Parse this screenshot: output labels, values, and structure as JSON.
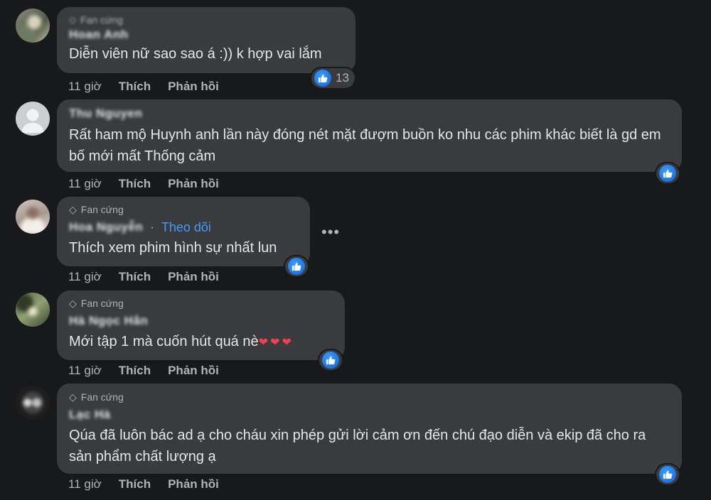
{
  "colors": {
    "background": "#18191a",
    "bubble": "#3a3b3c",
    "text": "#e4e6eb",
    "secondary_text": "#b0b3b8",
    "link": "#4599ff",
    "like_blue": "#0b63dd"
  },
  "comments": [
    {
      "badge": "Fan cứng",
      "author": "Hoan Anh",
      "text": "Diễn viên nữ sao sao á :)) k hợp vai lắm",
      "reaction_icon": "thumbs-up-icon",
      "reaction_count": "13",
      "time": "11 giờ",
      "like_label": "Thích",
      "reply_label": "Phản hồi"
    },
    {
      "author": "Thu Nguyen",
      "text": "Rất ham mộ Huynh anh lần này đóng nét mặt đượm buồn ko nhu các phim khác biết là gd em bố mới mất Thống cảm",
      "reaction_icon": "thumbs-up-icon",
      "time": "11 giờ",
      "like_label": "Thích",
      "reply_label": "Phản hồi"
    },
    {
      "badge": "Fan cứng",
      "author": "Hoa Nguyễn",
      "follow_label": "Theo dõi",
      "text": "Thích xem phim hình sự nhất lun",
      "more_label": "•••",
      "reaction_icon": "thumbs-up-icon",
      "time": "11 giờ",
      "like_label": "Thích",
      "reply_label": "Phản hồi"
    },
    {
      "badge": "Fan cứng",
      "author": "Hà Ngọc Hân",
      "text": "Mới tập 1 mà cuốn hút quá nè",
      "emoji": "❤❤❤",
      "reaction_icon": "thumbs-up-icon",
      "time": "11 giờ",
      "like_label": "Thích",
      "reply_label": "Phản hồi"
    },
    {
      "badge": "Fan cứng",
      "author": "Lạc Hà",
      "text": "Qúa đã luôn bác ad ạ cho cháu xin phép gửi lời cảm ơn đến chú đạo diễn và ekip đã cho ra sản phẩm chất lượng ạ",
      "reaction_icon": "thumbs-up-icon",
      "time": "11 giờ",
      "like_label": "Thích",
      "reply_label": "Phản hồi"
    }
  ]
}
